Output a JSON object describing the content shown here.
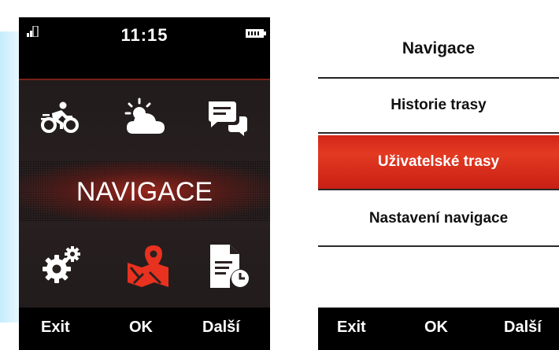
{
  "left_screen": {
    "status": {
      "time": "11:15",
      "signal_icon": "signal-icon",
      "battery_icon": "battery-icon"
    },
    "menu": {
      "icons_top": [
        "bicycle-icon",
        "weather-icon",
        "messages-icon"
      ],
      "highlighted_mode": "NAVIGACE",
      "icons_bottom": [
        "settings-icon",
        "map-icon",
        "history-icon"
      ]
    },
    "softkeys": {
      "exit": "Exit",
      "ok": "OK",
      "next": "Další"
    },
    "colors": {
      "accent": "#e8311f",
      "background": "#000000"
    }
  },
  "right_screen": {
    "title": "Navigace",
    "items": [
      {
        "label": "Historie trasy",
        "selected": false
      },
      {
        "label": "Uživatelské trasy",
        "selected": true
      },
      {
        "label": "Nastavení navigace",
        "selected": false
      }
    ],
    "softkeys": {
      "exit": "Exit",
      "ok": "OK",
      "next": "Další"
    },
    "colors": {
      "selection": "#d92a1c"
    }
  }
}
